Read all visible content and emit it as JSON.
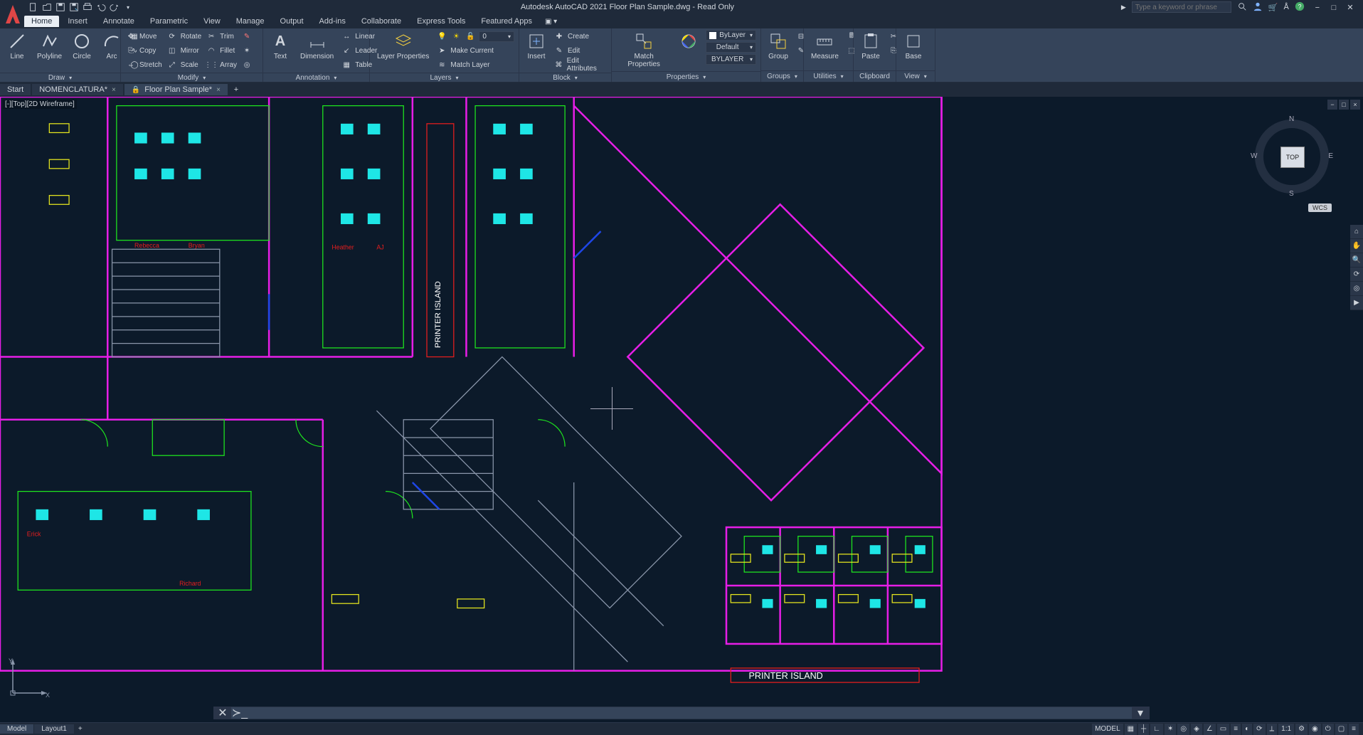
{
  "title": "Autodesk AutoCAD 2021   Floor Plan Sample.dwg - Read Only",
  "search_placeholder": "Type a keyword or phrase",
  "menu_tabs": [
    "Home",
    "Insert",
    "Annotate",
    "Parametric",
    "View",
    "Manage",
    "Output",
    "Add-ins",
    "Collaborate",
    "Express Tools",
    "Featured Apps"
  ],
  "active_menu_tab": "Home",
  "ribbon": {
    "draw": {
      "title": "Draw",
      "big": [
        "Line",
        "Polyline",
        "Circle",
        "Arc"
      ]
    },
    "modify": {
      "title": "Modify",
      "rows": [
        [
          "Move",
          "Rotate",
          "Trim"
        ],
        [
          "Copy",
          "Mirror",
          "Fillet"
        ],
        [
          "Stretch",
          "Scale",
          "Array"
        ]
      ]
    },
    "annotation": {
      "title": "Annotation",
      "text": "Text",
      "dimension": "Dimension",
      "rows": [
        "Linear",
        "Leader",
        "Table"
      ]
    },
    "layers": {
      "title": "Layers",
      "props": "Layer Properties",
      "rows": [
        "Make Current",
        "Match Layer"
      ]
    },
    "block": {
      "title": "Block",
      "insert": "Insert",
      "rows": [
        "Create",
        "Edit",
        "Edit Attributes"
      ]
    },
    "properties": {
      "title": "Properties",
      "match": "Match Properties",
      "layer_dd": "ByLayer",
      "lw_dd": "Default",
      "lt_dd": "BYLAYER"
    },
    "groups": {
      "title": "Groups",
      "group": "Group"
    },
    "utilities": {
      "title": "Utilities",
      "measure": "Measure"
    },
    "clipboard": {
      "title": "Clipboard",
      "paste": "Paste"
    },
    "view": {
      "title": "View",
      "base": "Base"
    }
  },
  "doc_tabs": [
    {
      "label": "Start",
      "closable": false,
      "lock": false
    },
    {
      "label": "NOMENCLATURA*",
      "closable": true,
      "lock": false
    },
    {
      "label": "Floor Plan Sample*",
      "closable": true,
      "lock": true
    }
  ],
  "active_doc_tab": 2,
  "viewport_label": "[-][Top][2D Wireframe]",
  "viewcube": {
    "face": "TOP",
    "n": "N",
    "s": "S",
    "e": "E",
    "w": "W"
  },
  "wcs": "WCS",
  "layout_tabs": [
    "Model",
    "Layout1"
  ],
  "active_layout_tab": 0,
  "status": {
    "model": "MODEL",
    "scale": "1:1"
  },
  "printer_island": "PRINTER  ISLAND",
  "ucs_labels": {
    "x": "X",
    "y": "Y"
  }
}
